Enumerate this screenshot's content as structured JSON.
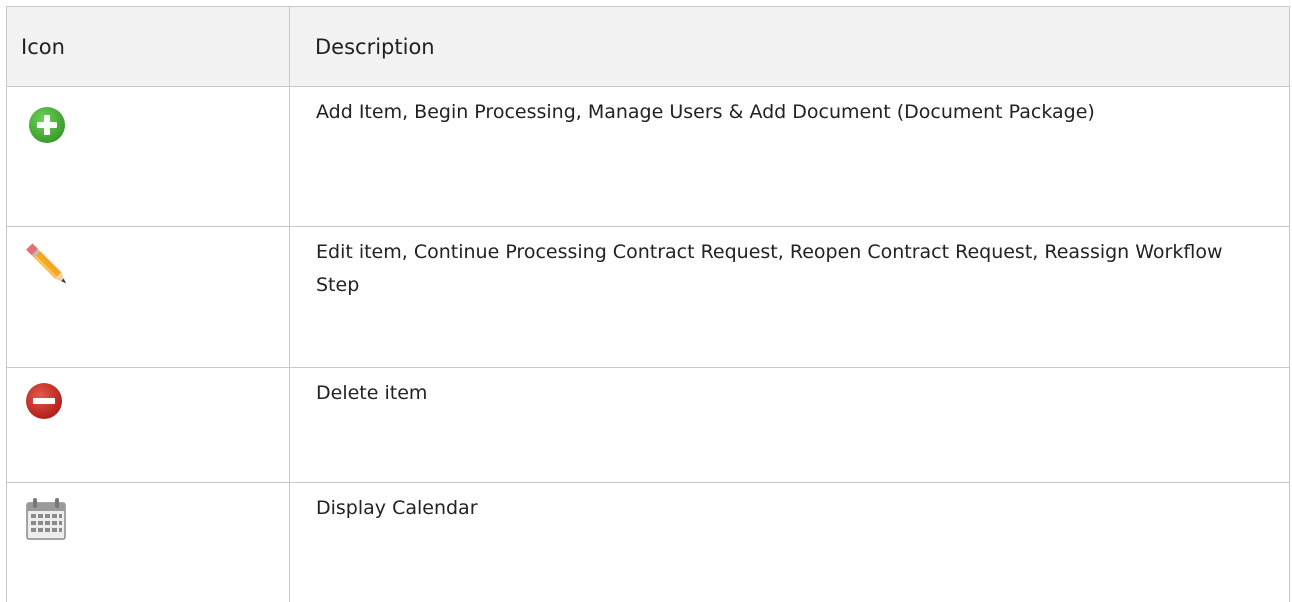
{
  "table": {
    "header": {
      "icon": "Icon",
      "description": "Description"
    },
    "rows": [
      {
        "icon": "plus-circle-green-icon",
        "description": "Add Item, Begin Processing, Manage Users & Add Document (Document Package)"
      },
      {
        "icon": "pencil-icon",
        "description": "Edit item, Continue Processing Contract Request, Reopen Contract Request, Reassign Workflow Step"
      },
      {
        "icon": "minus-circle-red-icon",
        "description": "Delete item"
      },
      {
        "icon": "calendar-icon",
        "description": "Display Calendar"
      }
    ]
  },
  "colors": {
    "add": "#4caf3c",
    "delete": "#c62c22",
    "pencil_body": "#f5a623",
    "header_bg": "#f2f2f2",
    "border": "#c8c8c8"
  }
}
